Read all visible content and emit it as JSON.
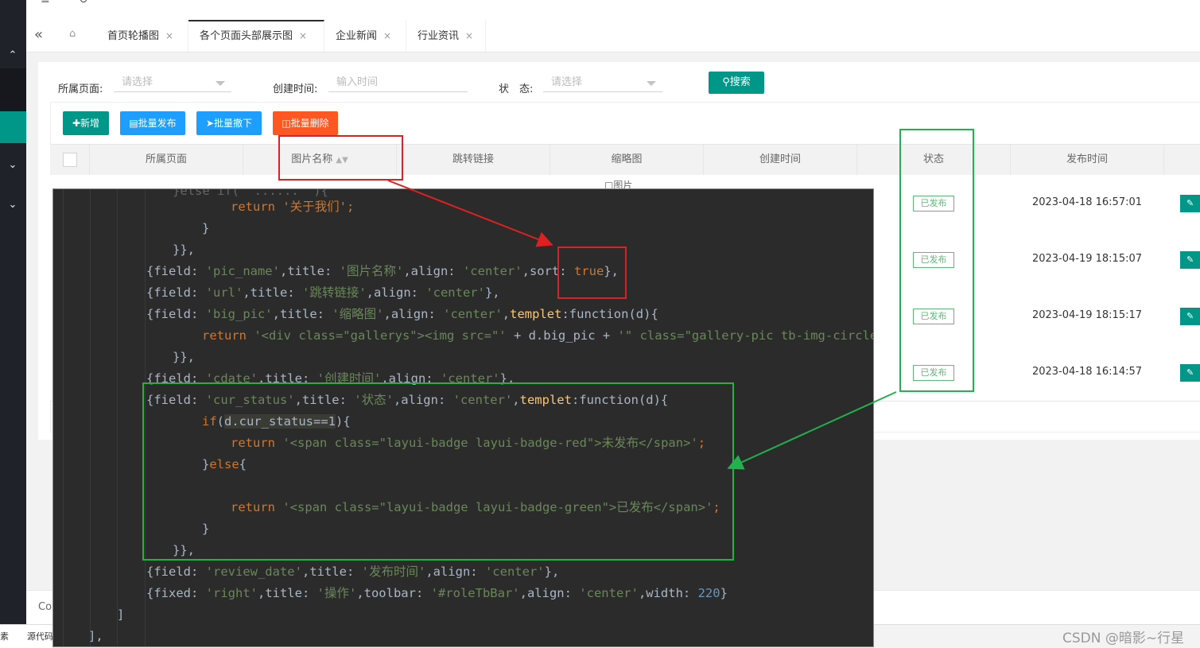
{
  "tabs": [
    {
      "label": "首页轮播图"
    },
    {
      "label": "各个页面头部展示图"
    },
    {
      "label": "企业新闻"
    },
    {
      "label": "行业资讯"
    }
  ],
  "tab_close": "×",
  "filters": {
    "page_label": "所属页面:",
    "page_placeholder": "请选择",
    "date_label": "创建时间:",
    "date_placeholder": "输入时间",
    "status_label": "状　态:",
    "status_placeholder": "请选择",
    "search_label": "搜索"
  },
  "toolbar": {
    "add": "新增",
    "batch_publish": "批量发布",
    "batch_withdraw": "批量撤下",
    "batch_delete": "批量删除"
  },
  "columns": [
    "所属页面",
    "图片名称",
    "跳转链接",
    "缩略图",
    "创建时间",
    "状态",
    "发布时间"
  ],
  "thumb_alt": "图片",
  "rows": [
    {
      "status": "已发布",
      "publish_time": "2023-04-18 16:57:01"
    },
    {
      "status": "已发布",
      "publish_time": "2023-04-19 18:15:07"
    },
    {
      "status": "已发布",
      "publish_time": "2023-04-19 18:15:17"
    },
    {
      "status": "已发布",
      "publish_time": "2023-04-18 16:14:57"
    }
  ],
  "footer_stub": "Co",
  "devtools_tabs": [
    "素",
    "源代码"
  ],
  "watermark": "CSDN @暗影~行星",
  "code": {
    "l1": "return '关于我们';",
    "l2": "}",
    "l3": "}},",
    "l4a": "{field: ",
    "l4b": "'pic_name'",
    "l4c": ",title: ",
    "l4d": "'图片名称'",
    "l4e": ",align: ",
    "l4f": "'center'",
    "l4g": ",sort: ",
    "l4h": "true",
    "l4i": "},",
    "l5a": "{field: ",
    "l5b": "'url'",
    "l5c": ",title: ",
    "l5d": "'跳转链接'",
    "l5e": ",align: ",
    "l5f": "'center'",
    "l5g": "},",
    "l6a": "{field: ",
    "l6b": "'big_pic'",
    "l6c": ",title: ",
    "l6d": "'缩略图'",
    "l6e": ",align: ",
    "l6f": "'center'",
    "l6g": ",",
    "l6h": "templet",
    "l6i": ":function(d){",
    "l7a": "return ",
    "l7b": "'<div class=\"gallerys\"><img src=\"'",
    "l7c": " + d.big_pic + ",
    "l7d": "'\" class=\"gallery-pic tb-img-circle\" a",
    "l8": "}},",
    "l9a": "{field: ",
    "l9b": "'cdate'",
    "l9c": ",title: ",
    "l9d": "'创建时间'",
    "l9e": ",align: ",
    "l9f": "'center'",
    "l9g": "},",
    "l10a": "{field: ",
    "l10b": "'cur_status'",
    "l10c": ",title: ",
    "l10d": "'状态'",
    "l10e": ",align: ",
    "l10f": "'center'",
    "l10g": ",",
    "l10h": "templet",
    "l10i": ":function(d){",
    "l11a": "if",
    "l11b": "(",
    "l11c": "d.cur_status==1",
    "l11d": "){",
    "l12a": "return ",
    "l12b": "'<span class=\"layui-badge layui-badge-red\">未发布</span>'",
    "l12c": ";",
    "l13a": "}",
    "l13b": "else",
    "l13c": "{",
    "l14a": "return ",
    "l14b": "'<span class=\"layui-badge layui-badge-green\">已发布</span>'",
    "l14c": ";",
    "l15": "}",
    "l16": "}},",
    "l17a": "{field: ",
    "l17b": "'review_date'",
    "l17c": ",title: ",
    "l17d": "'发布时间'",
    "l17e": ",align: ",
    "l17f": "'center'",
    "l17g": "},",
    "l18a": "{fixed: ",
    "l18b": "'right'",
    "l18c": ",title: ",
    "l18d": "'操作'",
    "l18e": ",toolbar: ",
    "l18f": "'#roleTbBar'",
    "l18g": ",align: ",
    "l18h": "'center'",
    "l18i": ",width: ",
    "l18j": "220",
    "l18k": "}",
    "l19": "]",
    "l20": "],"
  },
  "colors": {
    "accent": "#009688",
    "blue": "#1e9fff",
    "orange": "#ff5722",
    "badge_green": "#5FB878",
    "annot_red": "#e02020",
    "annot_green": "#22b14c"
  }
}
